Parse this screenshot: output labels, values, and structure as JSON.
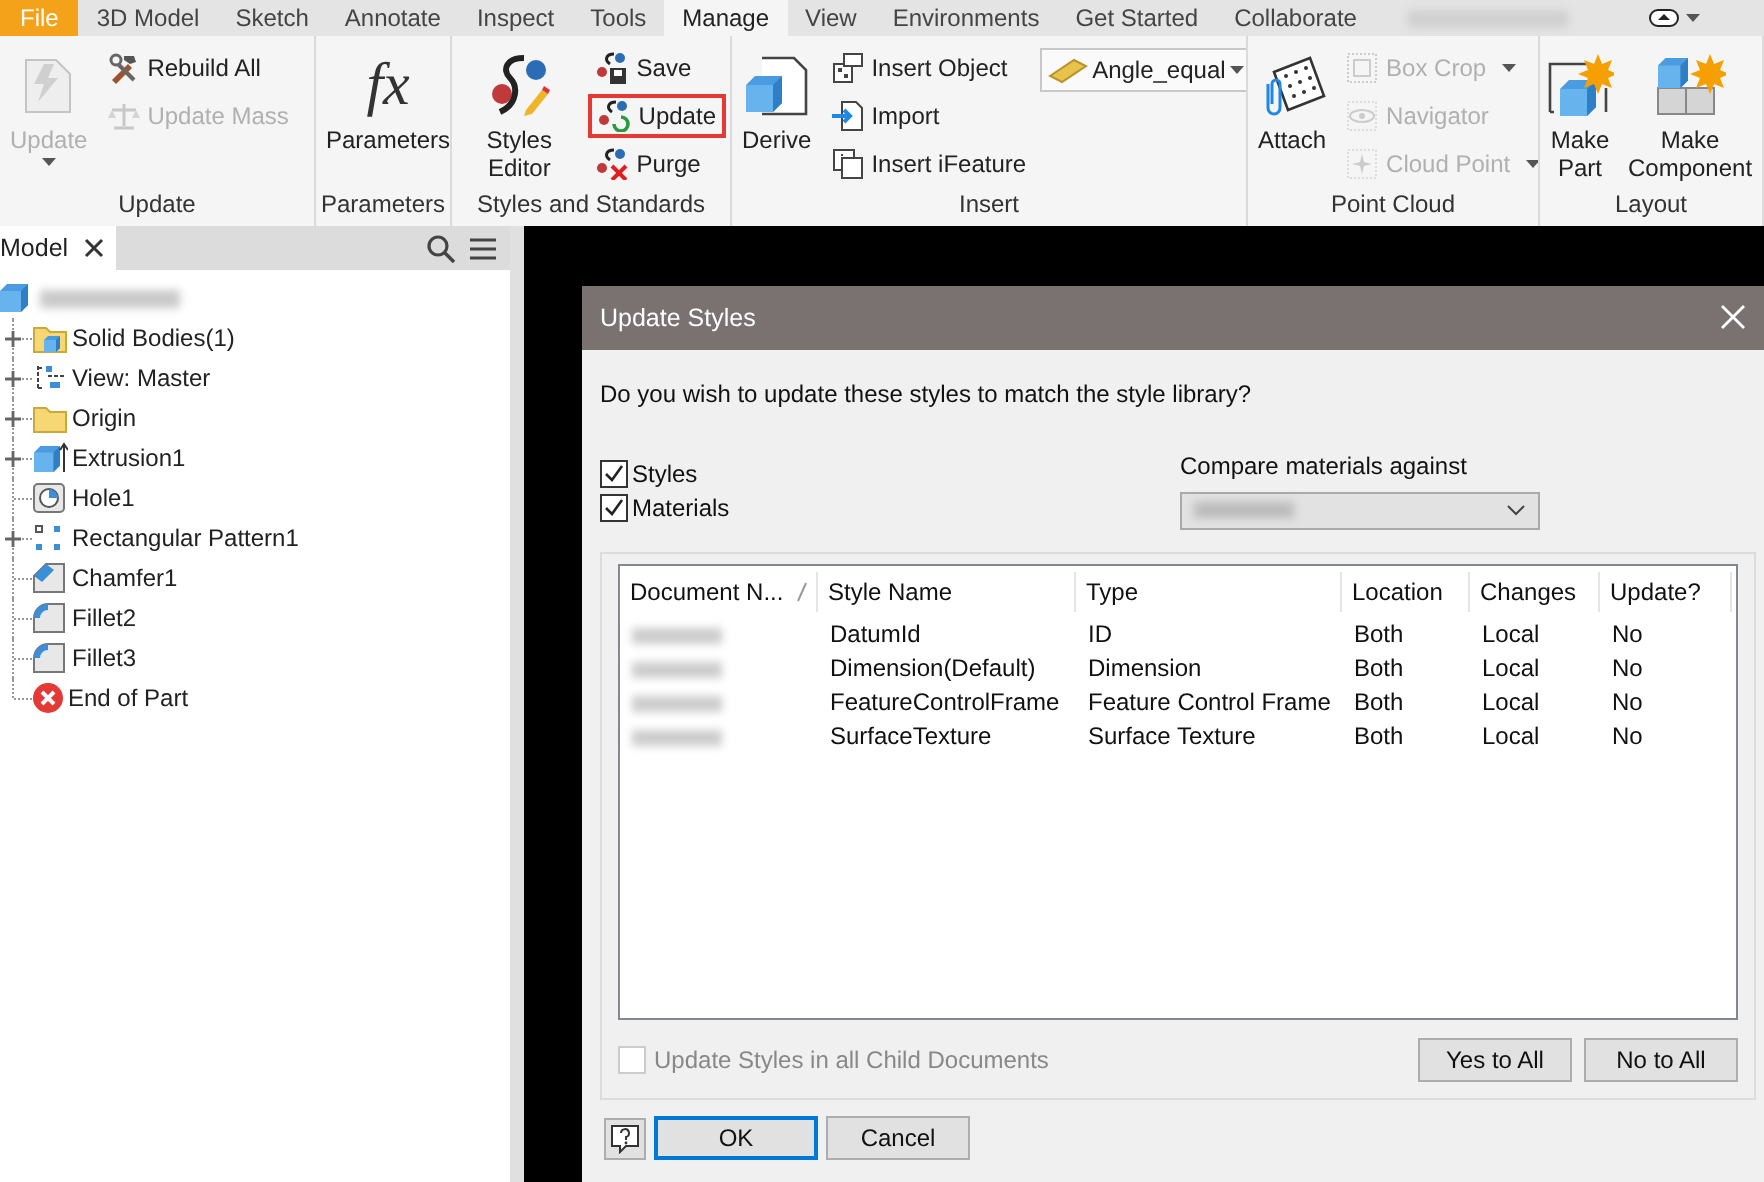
{
  "tabs": [
    {
      "label": "File",
      "kind": "app",
      "selected": false
    },
    {
      "label": "3D Model",
      "kind": "tab",
      "selected": false
    },
    {
      "label": "Sketch",
      "kind": "tab",
      "selected": false
    },
    {
      "label": "Annotate",
      "kind": "tab",
      "selected": false
    },
    {
      "label": "Inspect",
      "kind": "tab",
      "selected": false
    },
    {
      "label": "Tools",
      "kind": "tab",
      "selected": false
    },
    {
      "label": "Manage",
      "kind": "tab",
      "selected": true
    },
    {
      "label": "View",
      "kind": "tab",
      "selected": false
    },
    {
      "label": "Environments",
      "kind": "tab",
      "selected": false
    },
    {
      "label": "Get Started",
      "kind": "tab",
      "selected": false
    },
    {
      "label": "Collaborate",
      "kind": "tab",
      "selected": false
    }
  ],
  "ribbon": {
    "groups": [
      {
        "label": "Update",
        "items": [
          {
            "kind": "large",
            "label": "Update",
            "disabled": true,
            "menu": true,
            "highlighted": false
          },
          {
            "kind": "small",
            "label": "Rebuild All",
            "disabled": false,
            "menu": false,
            "highlighted": false
          },
          {
            "kind": "small",
            "label": "Update Mass",
            "disabled": true,
            "menu": false,
            "highlighted": false
          }
        ]
      },
      {
        "label": "Parameters",
        "items": [
          {
            "kind": "large",
            "label": "Parameters",
            "glyph": "fx",
            "disabled": false,
            "menu": false,
            "highlighted": false
          }
        ]
      },
      {
        "label": "Styles and Standards",
        "items": [
          {
            "kind": "large",
            "label": "Styles Editor",
            "disabled": false,
            "menu": false,
            "highlighted": false
          },
          {
            "kind": "small",
            "label": "Save",
            "disabled": false,
            "menu": false,
            "highlighted": false
          },
          {
            "kind": "small",
            "label": "Update",
            "disabled": false,
            "menu": false,
            "highlighted": true
          },
          {
            "kind": "small",
            "label": "Purge",
            "disabled": false,
            "menu": false,
            "highlighted": false
          }
        ]
      },
      {
        "label": "Insert",
        "items": [
          {
            "kind": "large",
            "label": "Derive",
            "disabled": false,
            "menu": false,
            "highlighted": false
          },
          {
            "kind": "small",
            "label": "Insert Object",
            "disabled": false,
            "menu": false,
            "highlighted": false
          },
          {
            "kind": "small",
            "label": "Import",
            "disabled": false,
            "menu": false,
            "highlighted": false
          },
          {
            "kind": "small",
            "label": "Insert iFeature",
            "disabled": false,
            "menu": false,
            "highlighted": false
          },
          {
            "kind": "combo",
            "label": "Angle_equal",
            "disabled": false,
            "menu": true,
            "highlighted": false
          }
        ]
      },
      {
        "label": "Point Cloud",
        "items": [
          {
            "kind": "large",
            "label": "Attach",
            "disabled": false,
            "menu": false,
            "highlighted": false
          },
          {
            "kind": "small",
            "label": "Box Crop",
            "disabled": true,
            "menu": true,
            "highlighted": false
          },
          {
            "kind": "small",
            "label": "Navigator",
            "disabled": true,
            "menu": false,
            "highlighted": false
          },
          {
            "kind": "small",
            "label": "Cloud Point",
            "disabled": true,
            "menu": true,
            "highlighted": false
          }
        ]
      },
      {
        "label": "Layout",
        "items": [
          {
            "kind": "large",
            "label": "Make Part",
            "disabled": false,
            "menu": false,
            "highlighted": false
          },
          {
            "kind": "large",
            "label": "Make Component",
            "disabled": false,
            "menu": false,
            "highlighted": false
          }
        ]
      }
    ]
  },
  "browser": {
    "title": "Model",
    "nodes": [
      {
        "label": "Solid Bodies(1)",
        "expandable": true
      },
      {
        "label": "View: Master",
        "expandable": true
      },
      {
        "label": "Origin",
        "expandable": true
      },
      {
        "label": "Extrusion1",
        "expandable": true
      },
      {
        "label": "Hole1",
        "expandable": false
      },
      {
        "label": "Rectangular Pattern1",
        "expandable": true
      },
      {
        "label": "Chamfer1",
        "expandable": false
      },
      {
        "label": "Fillet2",
        "expandable": false
      },
      {
        "label": "Fillet3",
        "expandable": false
      },
      {
        "label": "End of Part",
        "expandable": false
      }
    ]
  },
  "dialog": {
    "title": "Update Styles",
    "question": "Do you wish to update these styles to match the style library?",
    "options": [
      {
        "label": "Styles",
        "checked": true
      },
      {
        "label": "Materials",
        "checked": true
      }
    ],
    "compare_label": "Compare materials against",
    "columns": [
      "Document N...",
      "Style Name",
      "Type",
      "Location",
      "Changes",
      "Update?"
    ],
    "rows": [
      [
        "",
        "DatumId",
        "ID",
        "Both",
        "Local",
        "No"
      ],
      [
        "",
        "Dimension(Default)",
        "Dimension",
        "Both",
        "Local",
        "No"
      ],
      [
        "",
        "FeatureControlFrame",
        "Feature Control Frame",
        "Both",
        "Local",
        "No"
      ],
      [
        "",
        "SurfaceTexture",
        "Surface Texture",
        "Both",
        "Local",
        "No"
      ]
    ],
    "child_option": {
      "label": "Update Styles in all Child Documents",
      "checked": false,
      "disabled": true
    },
    "table_buttons": [
      "Yes to All",
      "No to All"
    ],
    "buttons": [
      {
        "label": "OK",
        "default": true
      },
      {
        "label": "Cancel",
        "default": false
      }
    ]
  }
}
